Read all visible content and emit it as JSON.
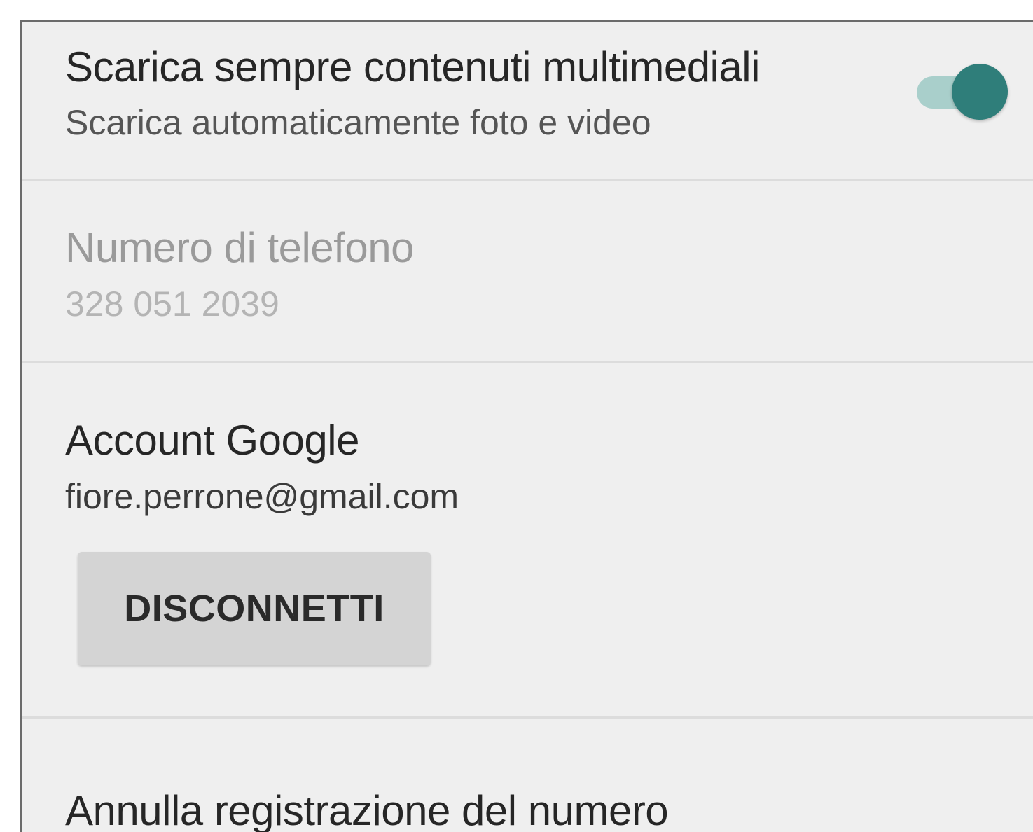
{
  "media": {
    "title": "Scarica sempre contenuti multimediali",
    "subtitle": "Scarica automaticamente foto e video",
    "toggle_on": true
  },
  "phone": {
    "title": "Numero di telefono",
    "value": "328 051 2039"
  },
  "google": {
    "title": "Account Google",
    "email": "fiore.perrone@gmail.com",
    "disconnect_label": "DISCONNETTI"
  },
  "unregister": {
    "title": "Annulla registrazione del numero"
  },
  "colors": {
    "accent": "#2f7e7a",
    "accent_track": "#a9cfcb",
    "background": "#efefef",
    "button_bg": "#d4d4d4"
  }
}
